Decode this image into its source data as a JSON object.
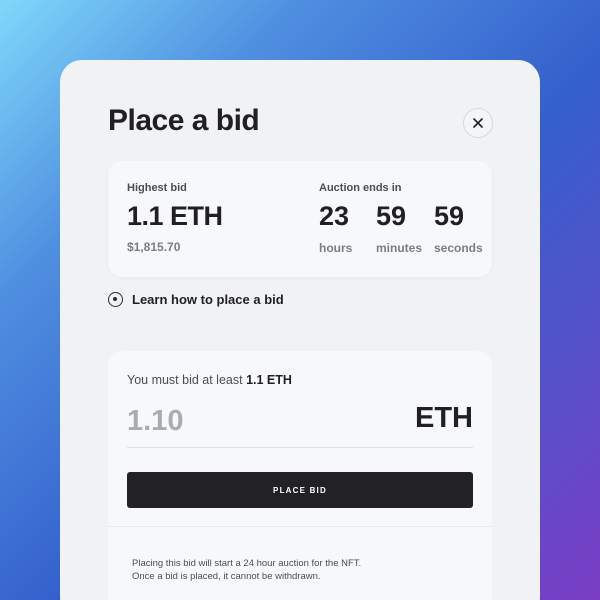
{
  "modal": {
    "title": "Place a bid",
    "close_icon": "close-icon"
  },
  "highest_bid": {
    "label": "Highest bid",
    "value": "1.1 ETH",
    "usd": "$1,815.70"
  },
  "auction": {
    "label": "Auction ends in",
    "hours": "23",
    "hours_label": "hours",
    "minutes": "59",
    "minutes_label": "minutes",
    "seconds": "59",
    "seconds_label": "seconds"
  },
  "learn": {
    "icon": "info-circle-icon",
    "text": "Learn how to place a bid"
  },
  "bid": {
    "prompt": "You must bid at least ",
    "minimum": "1.1 ETH",
    "placeholder": "1.10",
    "currency": "ETH",
    "button_label": "PLACE BID",
    "note_line1": "Placing this bid will start a 24 hour auction for the NFT.",
    "note_line2": "Once a bid is placed, it cannot be withdrawn."
  },
  "colors": {
    "modal_bg": "#f1f2f4",
    "card_bg": "#f7f8f9",
    "button_bg": "#222226",
    "text_primary": "#1f1f24",
    "text_muted": "#7a7d85"
  }
}
